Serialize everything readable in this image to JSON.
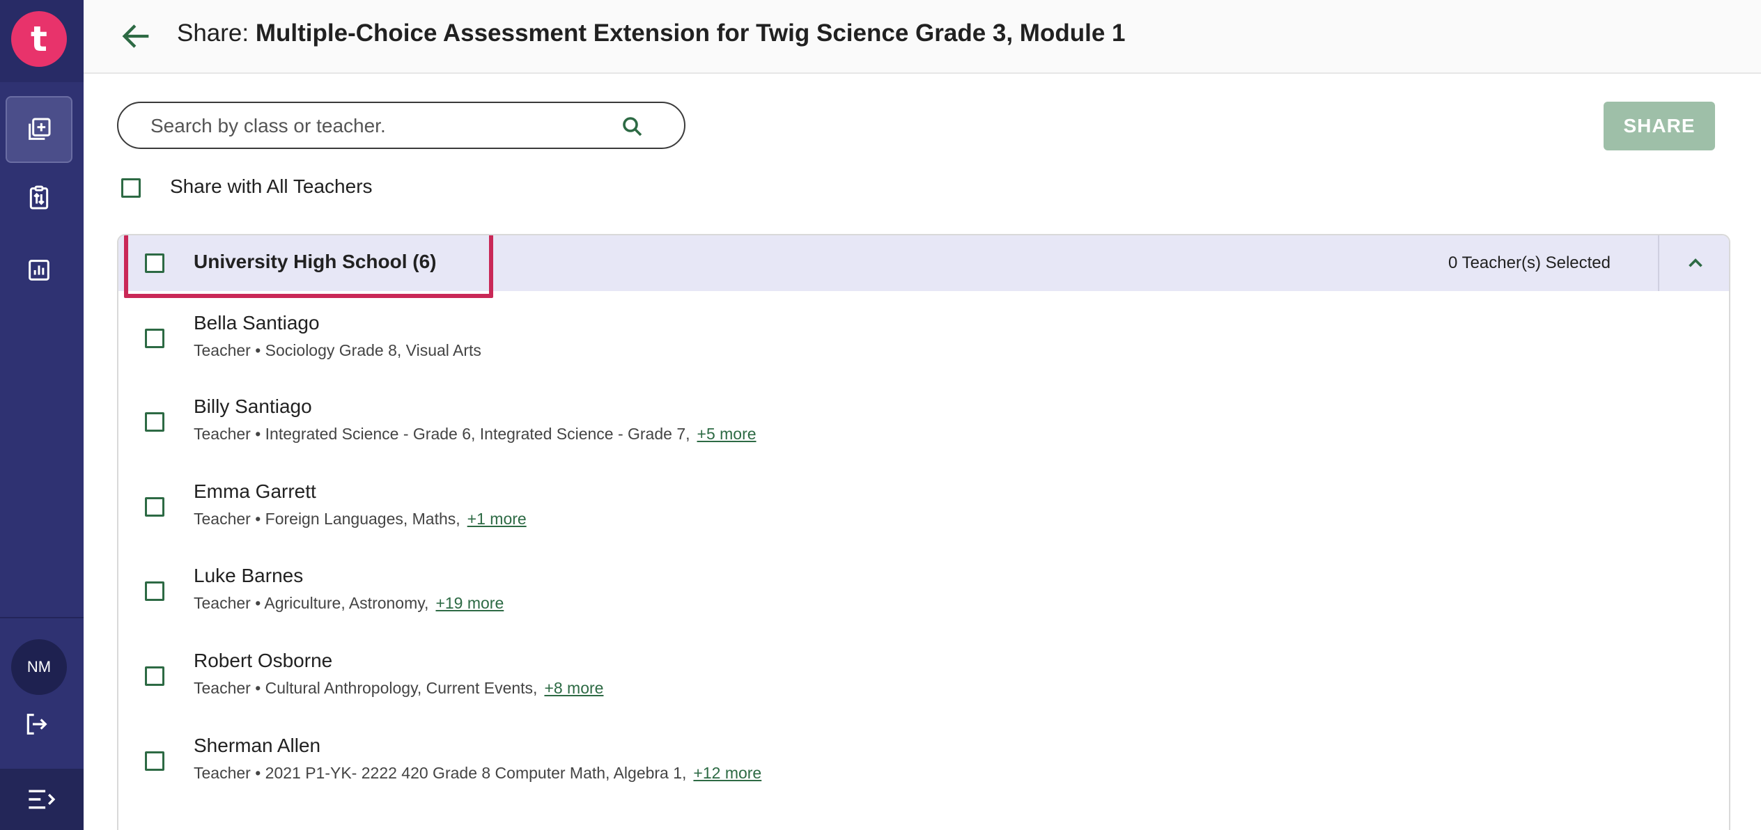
{
  "header": {
    "title_prefix": "Share: ",
    "title_main": "Multiple-Choice Assessment Extension for Twig Science Grade 3, Module 1"
  },
  "sidebar": {
    "logo_letter": "t",
    "avatar_initials": "NM",
    "icons": [
      "add-library-icon",
      "clipboard-icon",
      "chart-icon",
      "logout-icon",
      "menu-expand-icon"
    ]
  },
  "search": {
    "placeholder": "Search by class or teacher."
  },
  "share_button": "SHARE",
  "share_all_label": "Share with All Teachers",
  "group": {
    "name": "University High School (6)",
    "selected": "0 Teacher(s) Selected"
  },
  "teachers": [
    {
      "name": "Bella Santiago",
      "info": "Teacher • Sociology Grade 8, Visual Arts",
      "more": ""
    },
    {
      "name": "Billy Santiago",
      "info": "Teacher • Integrated Science - Grade 6, Integrated Science - Grade 7,",
      "more": "+5 more"
    },
    {
      "name": "Emma Garrett",
      "info": "Teacher • Foreign Languages, Maths,",
      "more": "+1 more"
    },
    {
      "name": "Luke Barnes",
      "info": "Teacher • Agriculture, Astronomy,",
      "more": "+19 more"
    },
    {
      "name": "Robert Osborne",
      "info": "Teacher • Cultural Anthropology, Current Events,",
      "more": "+8 more"
    },
    {
      "name": "Sherman Allen",
      "info": "Teacher • 2021 P1-YK- 2222 420 Grade 8 Computer Math, Algebra 1,",
      "more": "+12 more"
    }
  ],
  "colors": {
    "sidebar": "#2f3272",
    "brand": "#e8336b",
    "accent_green": "#2d6a44",
    "share_disabled": "#9ebfa8",
    "highlight": "#c92857"
  }
}
